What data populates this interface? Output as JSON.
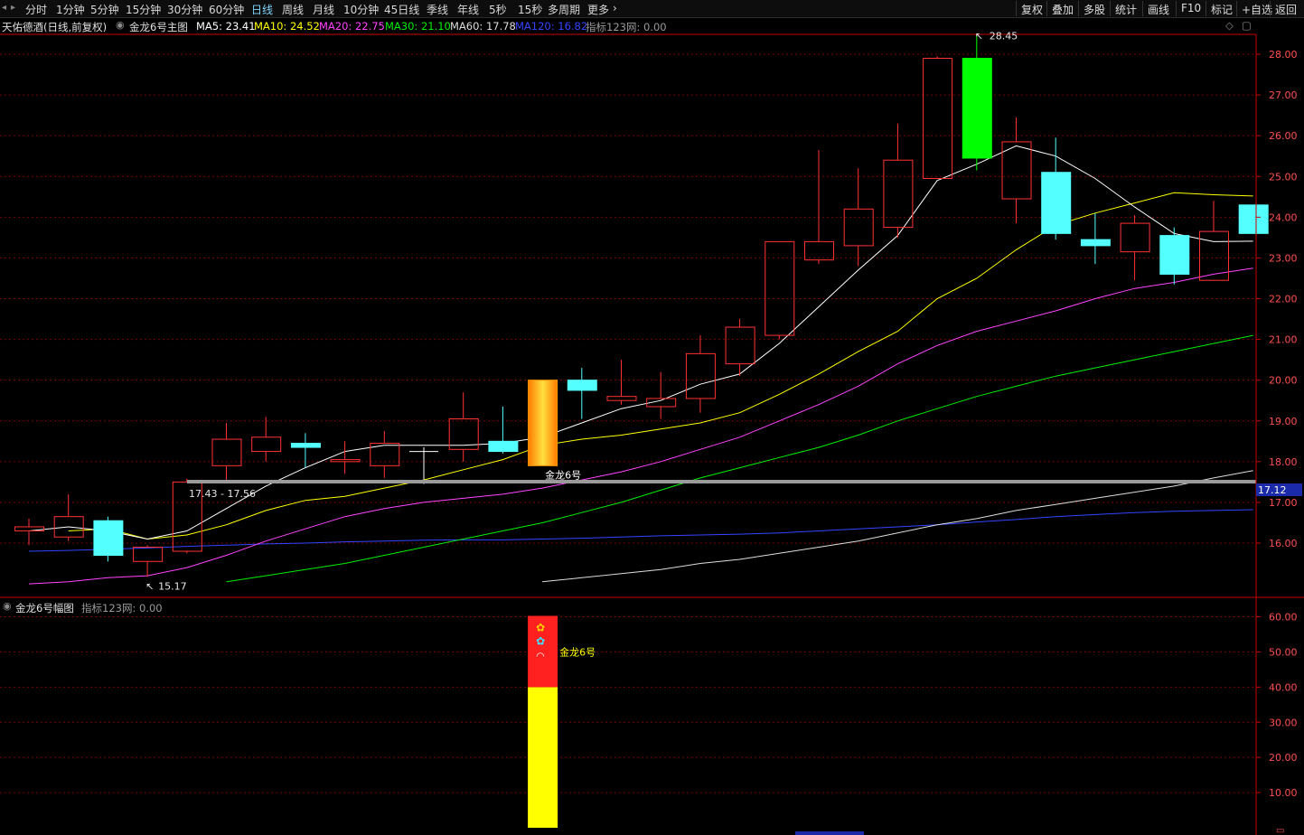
{
  "toolbar": {
    "periods": [
      "分时",
      "1分钟",
      "5分钟",
      "15分钟",
      "30分钟",
      "60分钟",
      "日线",
      "周线",
      "月线",
      "10分钟",
      "45日线",
      "季线",
      "年线",
      "5秒",
      "15秒",
      "多周期",
      "更多"
    ],
    "active": "日线",
    "right_buttons": [
      "复权",
      "叠加",
      "多股",
      "统计",
      "画线",
      "F10",
      "标记",
      "+自选",
      "返回"
    ]
  },
  "main_header": {
    "stock": "天佑德酒",
    "mode": "(日线,前复权)",
    "indicator": "金龙6号主图",
    "ma": [
      {
        "label": "MA5: 23.41",
        "color": "#ffffff"
      },
      {
        "label": "MA10: 24.52",
        "color": "#ffff00"
      },
      {
        "label": "MA20: 22.75",
        "color": "#ff44ff"
      },
      {
        "label": "MA30: 21.10",
        "color": "#00ee00"
      },
      {
        "label": "MA60: 17.78",
        "color": "#dddddd"
      },
      {
        "label": "MA120: 16.82",
        "color": "#3344ff"
      }
    ],
    "extra": "指标123网: 0.00"
  },
  "sub_header": {
    "indicator": "金龙6号幅图",
    "extra": "指标123网: 0.00"
  },
  "annotations": {
    "high_label": "28.45",
    "low_label": "15.17",
    "range_label": "17.43 - 17.56",
    "signal_label": "金龙6号",
    "sub_signal_label": "金龙6号",
    "current_price": "17.12"
  },
  "colors": {
    "up": "#ff3232",
    "down": "#54ffff",
    "ma5": "#ffffff",
    "ma10": "#ffff00",
    "ma20": "#ff44ff",
    "ma30": "#00ee00",
    "ma60": "#dddddd",
    "ma120": "#3344ff",
    "grid": "#7a0000",
    "axis": "#c80000"
  },
  "chart_data": {
    "type": "candlestick",
    "y_range": [
      15.0,
      28.8
    ],
    "y_ticks": [
      "28.00",
      "27.00",
      "26.00",
      "25.00",
      "24.00",
      "23.00",
      "22.00",
      "21.00",
      "20.00",
      "19.00",
      "18.00",
      "17.00",
      "16.00"
    ],
    "candles": [
      {
        "o": 16.3,
        "h": 16.6,
        "l": 15.95,
        "c": 16.4,
        "t": "up"
      },
      {
        "o": 16.15,
        "h": 17.2,
        "l": 16.05,
        "c": 16.65,
        "t": "up"
      },
      {
        "o": 16.55,
        "h": 16.65,
        "l": 15.55,
        "c": 15.7,
        "t": "down"
      },
      {
        "o": 15.55,
        "h": 15.95,
        "l": 15.17,
        "c": 15.9,
        "t": "up"
      },
      {
        "o": 15.8,
        "h": 17.58,
        "l": 15.75,
        "c": 17.5,
        "t": "up"
      },
      {
        "o": 17.9,
        "h": 18.95,
        "l": 17.55,
        "c": 18.55,
        "t": "up"
      },
      {
        "o": 18.25,
        "h": 19.1,
        "l": 18.0,
        "c": 18.6,
        "t": "up"
      },
      {
        "o": 18.45,
        "h": 18.7,
        "l": 17.85,
        "c": 18.35,
        "t": "down"
      },
      {
        "o": 18.0,
        "h": 18.5,
        "l": 17.7,
        "c": 18.05,
        "t": "up"
      },
      {
        "o": 17.9,
        "h": 18.75,
        "l": 17.6,
        "c": 18.45,
        "t": "up"
      },
      {
        "o": 18.25,
        "h": 18.35,
        "l": 17.45,
        "c": 18.25,
        "t": "flat"
      },
      {
        "o": 18.3,
        "h": 19.7,
        "l": 18.0,
        "c": 19.05,
        "t": "up"
      },
      {
        "o": 18.5,
        "h": 19.35,
        "l": 18.2,
        "c": 18.25,
        "t": "down"
      },
      {
        "o": 17.9,
        "h": 20.0,
        "l": 17.9,
        "c": 20.0,
        "t": "signal"
      },
      {
        "o": 20.0,
        "h": 20.3,
        "l": 19.05,
        "c": 19.75,
        "t": "down"
      },
      {
        "o": 19.5,
        "h": 20.5,
        "l": 19.4,
        "c": 19.6,
        "t": "up"
      },
      {
        "o": 19.35,
        "h": 20.2,
        "l": 19.05,
        "c": 19.55,
        "t": "up"
      },
      {
        "o": 19.55,
        "h": 21.1,
        "l": 19.2,
        "c": 20.65,
        "t": "up"
      },
      {
        "o": 20.4,
        "h": 21.5,
        "l": 20.1,
        "c": 21.3,
        "t": "up"
      },
      {
        "o": 21.1,
        "h": 23.4,
        "l": 21.0,
        "c": 23.4,
        "t": "up"
      },
      {
        "o": 22.95,
        "h": 25.65,
        "l": 22.85,
        "c": 23.4,
        "t": "up"
      },
      {
        "o": 23.3,
        "h": 25.2,
        "l": 22.8,
        "c": 24.2,
        "t": "up"
      },
      {
        "o": 23.75,
        "h": 26.3,
        "l": 23.5,
        "c": 25.4,
        "t": "up"
      },
      {
        "o": 24.95,
        "h": 27.95,
        "l": 24.95,
        "c": 27.9,
        "t": "up"
      },
      {
        "o": 27.9,
        "h": 28.45,
        "l": 25.15,
        "c": 25.45,
        "t": "green"
      },
      {
        "o": 24.45,
        "h": 26.45,
        "l": 23.85,
        "c": 25.85,
        "t": "up"
      },
      {
        "o": 25.1,
        "h": 25.95,
        "l": 23.45,
        "c": 23.6,
        "t": "down"
      },
      {
        "o": 23.45,
        "h": 24.1,
        "l": 22.85,
        "c": 23.3,
        "t": "down"
      },
      {
        "o": 23.15,
        "h": 24.05,
        "l": 22.45,
        "c": 23.85,
        "t": "up"
      },
      {
        "o": 23.55,
        "h": 23.75,
        "l": 22.35,
        "c": 22.6,
        "t": "down"
      },
      {
        "o": 22.45,
        "h": 24.4,
        "l": 22.45,
        "c": 23.65,
        "t": "up"
      },
      {
        "o": 24.3,
        "h": 24.3,
        "l": 23.6,
        "c": 23.6,
        "t": "down"
      }
    ],
    "ma5": [
      16.3,
      16.4,
      16.3,
      16.1,
      16.3,
      16.85,
      17.4,
      17.85,
      18.25,
      18.4,
      18.4,
      18.4,
      18.45,
      18.6,
      18.95,
      19.3,
      19.5,
      19.9,
      20.15,
      20.9,
      21.8,
      22.7,
      23.55,
      24.9,
      25.3,
      25.75,
      25.5,
      24.95,
      24.25,
      23.6,
      23.4,
      23.41
    ],
    "ma10": [
      null,
      16.3,
      16.35,
      16.1,
      16.2,
      16.45,
      16.8,
      17.05,
      17.15,
      17.35,
      17.55,
      17.8,
      18.05,
      18.4,
      18.55,
      18.65,
      18.8,
      18.95,
      19.2,
      19.65,
      20.15,
      20.7,
      21.2,
      22.0,
      22.5,
      23.2,
      23.8,
      24.1,
      24.35,
      24.6,
      24.55,
      24.52
    ],
    "ma20": [
      15.0,
      15.05,
      15.15,
      15.2,
      15.4,
      15.7,
      16.05,
      16.35,
      16.65,
      16.85,
      17.0,
      17.1,
      17.2,
      17.35,
      17.55,
      17.75,
      18.0,
      18.3,
      18.6,
      19.0,
      19.4,
      19.85,
      20.4,
      20.85,
      21.2,
      21.45,
      21.7,
      22.0,
      22.25,
      22.4,
      22.6,
      22.75
    ],
    "ma30": [
      null,
      null,
      null,
      null,
      null,
      15.05,
      15.2,
      15.35,
      15.5,
      15.7,
      15.9,
      16.1,
      16.3,
      16.5,
      16.75,
      17.0,
      17.3,
      17.6,
      17.85,
      18.1,
      18.35,
      18.65,
      19.0,
      19.3,
      19.6,
      19.85,
      20.1,
      20.3,
      20.5,
      20.7,
      20.9,
      21.1
    ],
    "ma60": [
      null,
      null,
      null,
      null,
      null,
      null,
      null,
      null,
      null,
      null,
      null,
      null,
      null,
      15.05,
      15.15,
      15.25,
      15.35,
      15.5,
      15.6,
      15.75,
      15.9,
      16.05,
      16.25,
      16.45,
      16.6,
      16.8,
      16.95,
      17.1,
      17.25,
      17.4,
      17.6,
      17.78
    ],
    "ma120": [
      15.8,
      15.82,
      15.85,
      15.88,
      15.92,
      15.95,
      15.98,
      16.0,
      16.03,
      16.05,
      16.07,
      16.08,
      16.08,
      16.1,
      16.12,
      16.15,
      16.18,
      16.2,
      16.22,
      16.25,
      16.3,
      16.35,
      16.4,
      16.45,
      16.52,
      16.58,
      16.65,
      16.7,
      16.75,
      16.78,
      16.8,
      16.82
    ],
    "sub_y_range": [
      0,
      65
    ],
    "sub_y_ticks": [
      "60.00",
      "50.00",
      "40.00",
      "30.00",
      "20.00",
      "10.00"
    ],
    "sub_bar": {
      "index": 13,
      "yellow_top": 40,
      "red_top": 60
    }
  }
}
